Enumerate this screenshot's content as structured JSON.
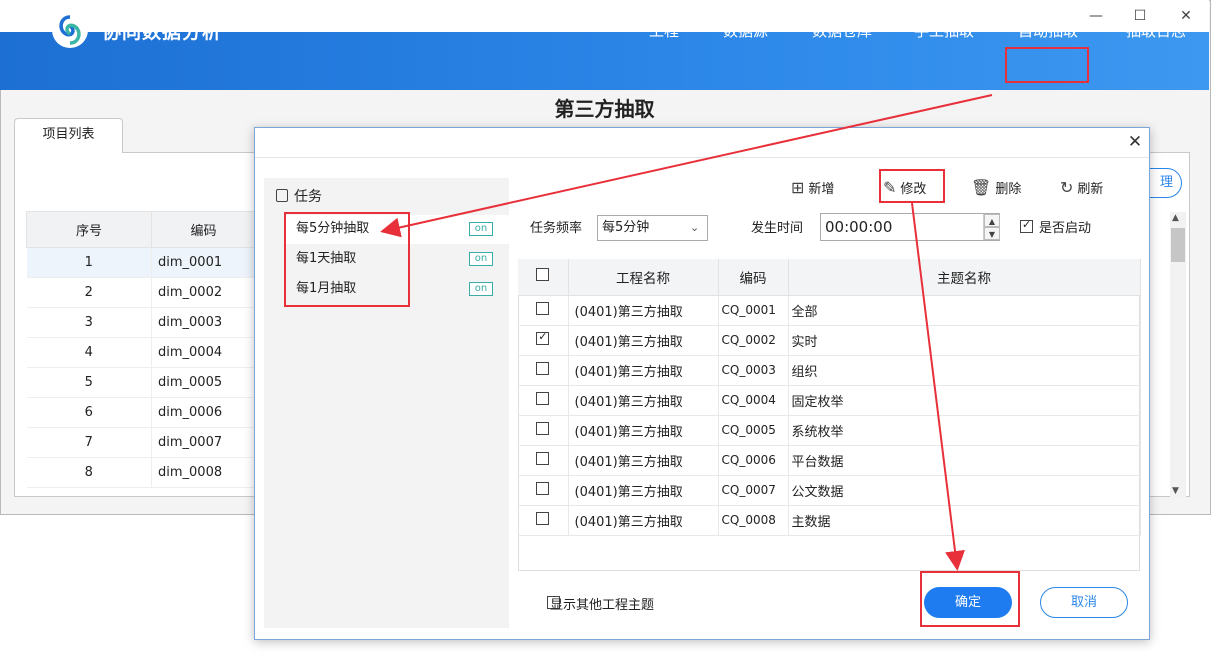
{
  "window": {
    "minimize_glyph": "—",
    "maximize_glyph": "☐",
    "close_glyph": "✕"
  },
  "header": {
    "app_title": "协同数据分析",
    "nav": [
      "工程",
      "数据源",
      "数据仓库",
      "手工抽取",
      "自动抽取",
      "抽取日志"
    ],
    "highlighted_nav": "自动抽取"
  },
  "page": {
    "title": "第三方抽取",
    "tab": "项目列表",
    "button_partial": "理"
  },
  "background_table": {
    "headers": [
      "序号",
      "编码"
    ],
    "rows": [
      [
        "1",
        "dim_0001"
      ],
      [
        "2",
        "dim_0002"
      ],
      [
        "3",
        "dim_0003"
      ],
      [
        "4",
        "dim_0004"
      ],
      [
        "5",
        "dim_0005"
      ],
      [
        "6",
        "dim_0006"
      ],
      [
        "7",
        "dim_0007"
      ],
      [
        "8",
        "dim_0008"
      ]
    ]
  },
  "dialog": {
    "close_glyph": "✕",
    "tree_root": "任务",
    "tasks": [
      {
        "label": "每5分钟抽取",
        "status": "on"
      },
      {
        "label": "每1天抽取",
        "status": "on"
      },
      {
        "label": "每1月抽取",
        "status": "on"
      }
    ],
    "toolbar": {
      "add": "新增",
      "edit": "修改",
      "delete": "删除",
      "refresh": "刷新"
    },
    "form": {
      "frequency_label": "任务频率",
      "frequency_value": "每5分钟",
      "time_label": "发生时间",
      "time_value": "00:00:00",
      "enabled_label": "是否启动",
      "enabled": true
    },
    "grid": {
      "headers": [
        "工程名称",
        "编码",
        "主题名称"
      ],
      "rows": [
        {
          "checked": false,
          "project": "(0401)第三方抽取",
          "code": "CQ_0001",
          "topic": "全部"
        },
        {
          "checked": true,
          "project": "(0401)第三方抽取",
          "code": "CQ_0002",
          "topic": "实时"
        },
        {
          "checked": false,
          "project": "(0401)第三方抽取",
          "code": "CQ_0003",
          "topic": "组织"
        },
        {
          "checked": false,
          "project": "(0401)第三方抽取",
          "code": "CQ_0004",
          "topic": "固定枚举"
        },
        {
          "checked": false,
          "project": "(0401)第三方抽取",
          "code": "CQ_0005",
          "topic": "系统枚举"
        },
        {
          "checked": false,
          "project": "(0401)第三方抽取",
          "code": "CQ_0006",
          "topic": "平台数据"
        },
        {
          "checked": false,
          "project": "(0401)第三方抽取",
          "code": "CQ_0007",
          "topic": "公文数据"
        },
        {
          "checked": false,
          "project": "(0401)第三方抽取",
          "code": "CQ_0008",
          "topic": "主数据"
        }
      ]
    },
    "show_other_label": "显示其他工程主题",
    "ok_label": "确定",
    "cancel_label": "取消"
  },
  "annotation_color": "#e8303a",
  "accent_color": "#1e7cf0"
}
